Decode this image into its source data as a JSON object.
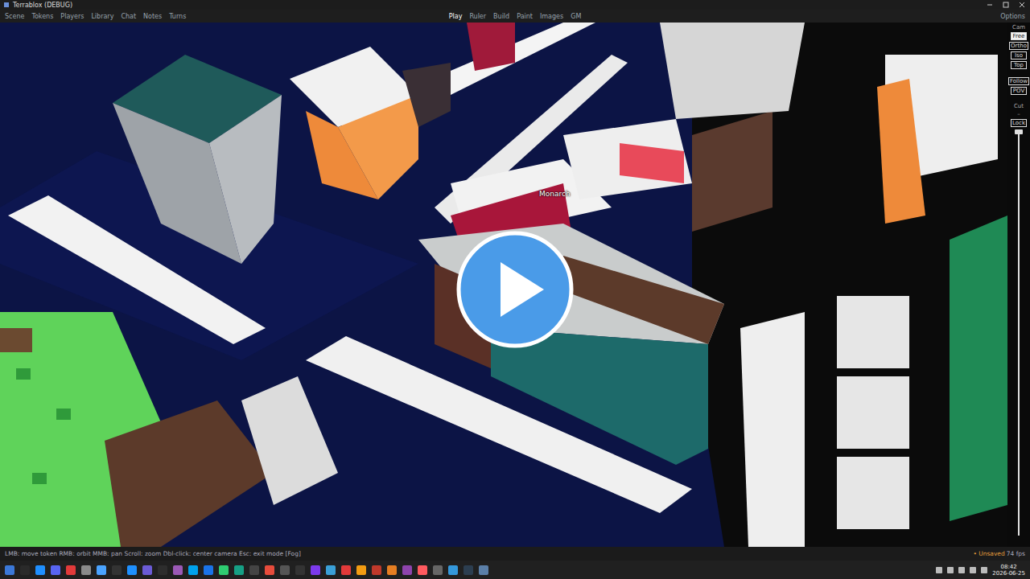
{
  "window": {
    "title": "Terrablox (DEBUG)"
  },
  "menu": {
    "items": [
      "Scene",
      "Tokens",
      "Players",
      "Library",
      "Chat",
      "Notes",
      "Turns"
    ],
    "modes": [
      {
        "label": "Play",
        "selected": true
      },
      {
        "label": "Ruler",
        "selected": false
      },
      {
        "label": "Build",
        "selected": false
      },
      {
        "label": "Paint",
        "selected": false
      },
      {
        "label": "Images",
        "selected": false
      },
      {
        "label": "GM",
        "selected": false
      }
    ],
    "options": "Options"
  },
  "camera_panel": {
    "title": "Cam",
    "modes": [
      {
        "label": "Free",
        "selected": true
      },
      {
        "label": "Ortho",
        "selected": false
      },
      {
        "label": "Iso",
        "selected": false
      },
      {
        "label": "Top",
        "selected": false
      }
    ],
    "toggles": [
      {
        "label": "Follow",
        "on": false
      },
      {
        "label": "POV",
        "on": false
      }
    ],
    "cut": {
      "label": "Cut",
      "value": "–"
    },
    "lock": {
      "label": "Lock",
      "on": false
    },
    "slider": {
      "level": 1
    }
  },
  "scene": {
    "tokens": [
      {
        "label": "Monarch"
      }
    ]
  },
  "status_bar": {
    "hints": "LMB: move token   RMB: orbit   MMB: pan   Scroll: zoom   Dbl-click: center camera   Esc: exit mode [Fog]",
    "save_state": "• Unsaved",
    "fps": "74 fps"
  },
  "taskbar": {
    "time": "08:42",
    "date": "2026-06-25"
  }
}
